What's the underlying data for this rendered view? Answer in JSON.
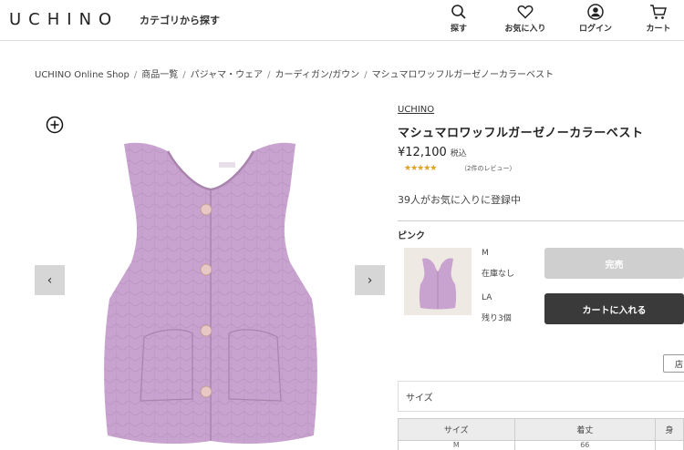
{
  "header": {
    "logo": "UCHINO",
    "category_link": "カテゴリから探す",
    "nav": {
      "search": "探す",
      "favorites": "お気に入り",
      "login": "ログイン",
      "cart": "カート"
    }
  },
  "breadcrumb": [
    "UCHINO Online Shop",
    "商品一覧",
    "パジャマ・ウェア",
    "カーディガン/ガウン",
    "マシュマロワッフルガーゼノーカラーベスト"
  ],
  "product": {
    "brand": "UCHINO",
    "name": "マシュマロワッフルガーゼノーカラーベスト",
    "price": "¥12,100",
    "tax_label": "税込",
    "stars": "★★★★★",
    "review_count": "（2件のレビュー）",
    "favorite_count": "39人がお気に入りに登録中",
    "color_label": "ピンク",
    "variants": [
      {
        "size": "M",
        "stock": "在庫なし",
        "button": "完売"
      },
      {
        "size": "LA",
        "stock": "残り3個",
        "button": "カートに入れる"
      }
    ],
    "store_button": "店",
    "size_section_label": "サイズ",
    "size_table": {
      "headers": [
        "サイズ",
        "着丈",
        "身"
      ],
      "rows": [
        [
          "M",
          "66",
          ""
        ]
      ]
    }
  },
  "gallery": {
    "prev": "‹",
    "next": "›"
  },
  "colors": {
    "vest": "#c9a3cf",
    "button_dark": "#3a3a3a",
    "button_disabled": "#cfcfcf",
    "star": "#e0a020"
  }
}
